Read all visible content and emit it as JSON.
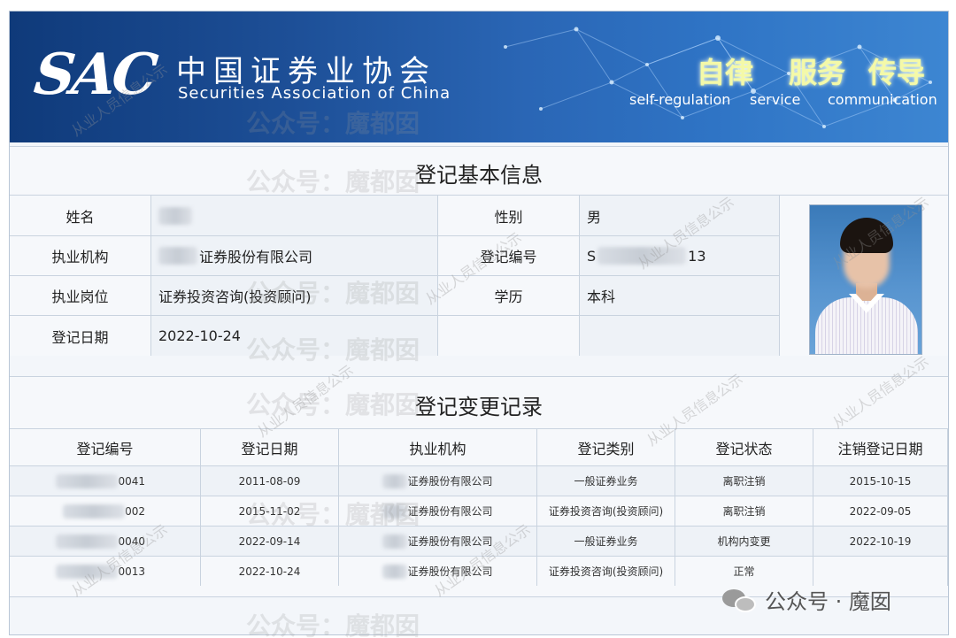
{
  "header": {
    "logo_text": "SAC",
    "org_name_cn": "中国证券业协会",
    "org_name_en": "Securities Association of China",
    "motto": [
      {
        "cn": "自律",
        "en": "self-regulation"
      },
      {
        "cn": "服务",
        "en": "service"
      },
      {
        "cn": "传导",
        "en": "communication"
      }
    ]
  },
  "basic": {
    "title": "登记基本信息",
    "name_label": "姓名",
    "name_value": "",
    "gender_label": "性别",
    "gender_value": "男",
    "org_label": "执业机构",
    "org_value": "证券股份有限公司",
    "regno_label": "登记编号",
    "regno_prefix": "S",
    "regno_suffix": "13",
    "position_label": "执业岗位",
    "position_value": "证券投资咨询(投资顾问)",
    "edu_label": "学历",
    "edu_value": "本科",
    "date_label": "登记日期",
    "date_value": "2022-10-24"
  },
  "changes": {
    "title": "登记变更记录",
    "headers": [
      "登记编号",
      "登记日期",
      "执业机构",
      "登记类别",
      "登记状态",
      "注销登记日期"
    ],
    "rows": [
      {
        "regno": "0041",
        "date": "2011-08-09",
        "org": "证券股份有限公司",
        "category": "一般证券业务",
        "status": "离职注销",
        "cancel_date": "2015-10-15"
      },
      {
        "regno": "002",
        "date": "2015-11-02",
        "org": "证券股份有限公司",
        "category": "证券投资咨询(投资顾问)",
        "status": "离职注销",
        "cancel_date": "2022-09-05"
      },
      {
        "regno": "0040",
        "date": "2022-09-14",
        "org": "证券股份有限公司",
        "category": "一般证券业务",
        "status": "机构内变更",
        "cancel_date": "2022-10-19"
      },
      {
        "regno": "0013",
        "date": "2022-10-24",
        "org": "证券股份有限公司",
        "category": "证券投资咨询(投资顾问)",
        "status": "正常",
        "cancel_date": ""
      }
    ]
  },
  "watermark": {
    "main": "公众号：魔都囡",
    "diag": "从业人员信息公示",
    "footer": "公众号 · 魔囡"
  }
}
